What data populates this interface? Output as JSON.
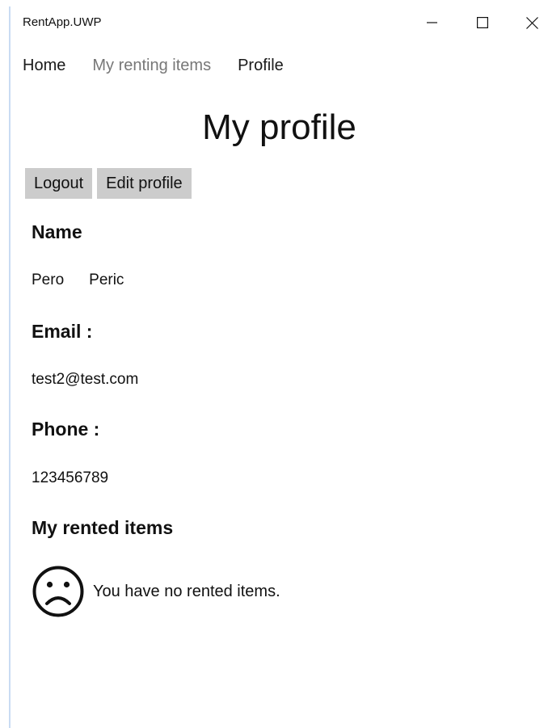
{
  "window": {
    "title": "RentApp.UWP",
    "controls": [
      "minimize",
      "maximize",
      "close"
    ]
  },
  "nav": {
    "items": [
      {
        "label": "Home",
        "state": "normal"
      },
      {
        "label": "My renting items",
        "state": "dimmed"
      },
      {
        "label": "Profile",
        "state": "current"
      }
    ]
  },
  "page": {
    "title": "My profile"
  },
  "actions": {
    "logout_label": "Logout",
    "edit_label": "Edit profile"
  },
  "profile": {
    "name_heading": "Name",
    "first_name": "Pero",
    "last_name": "Peric",
    "email_heading": "Email :",
    "email": "test2@test.com",
    "phone_heading": "Phone :",
    "phone": "123456789"
  },
  "rented": {
    "heading": "My rented items",
    "empty_icon": "sad-face-icon",
    "empty_message": "You have no rented items."
  },
  "colors": {
    "button_bg": "#cccccc",
    "nav_dim": "#777777",
    "window_border": "#c9dcf3"
  }
}
